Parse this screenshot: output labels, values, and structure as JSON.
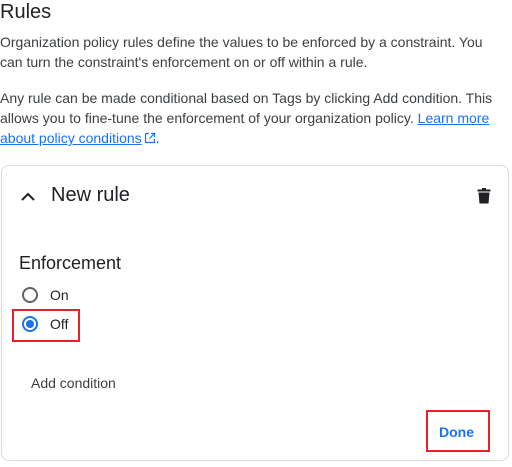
{
  "section": {
    "title": "Rules",
    "description_1": "Organization policy rules define the values to be enforced by a constraint. You can turn the constraint's enforcement on or off within a rule.",
    "description_2_prefix": "Any rule can be made conditional based on Tags by clicking Add condition. This allows you to fine-tune the enforcement of your organization policy. ",
    "link_text": "Learn more about policy conditions",
    "description_2_suffix": "."
  },
  "rule_card": {
    "title": "New rule",
    "enforcement_label": "Enforcement",
    "options": [
      {
        "label": "On",
        "selected": false
      },
      {
        "label": "Off",
        "selected": true
      }
    ],
    "add_condition_label": "Add condition",
    "done_label": "Done"
  },
  "colors": {
    "accent": "#1a73e8",
    "highlight": "#e8202a",
    "border": "#dadce0"
  },
  "icons": {
    "collapse": "chevron-up-icon",
    "delete": "trash-icon",
    "external_link": "external-link-icon"
  }
}
